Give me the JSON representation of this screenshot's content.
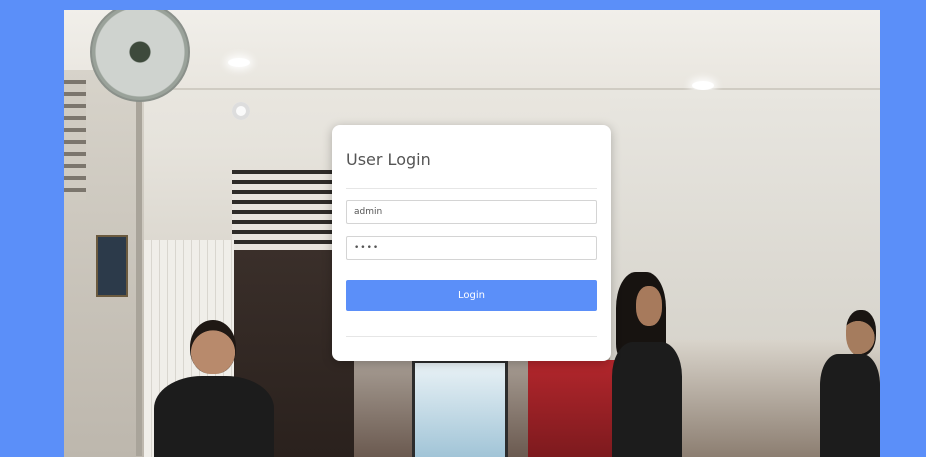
{
  "login": {
    "title": "User Login",
    "username_value": "admin",
    "password_value": "••••",
    "button_label": "Login"
  },
  "colors": {
    "accent": "#5b8ff9",
    "card": "#ffffff",
    "title_text": "#555555"
  }
}
